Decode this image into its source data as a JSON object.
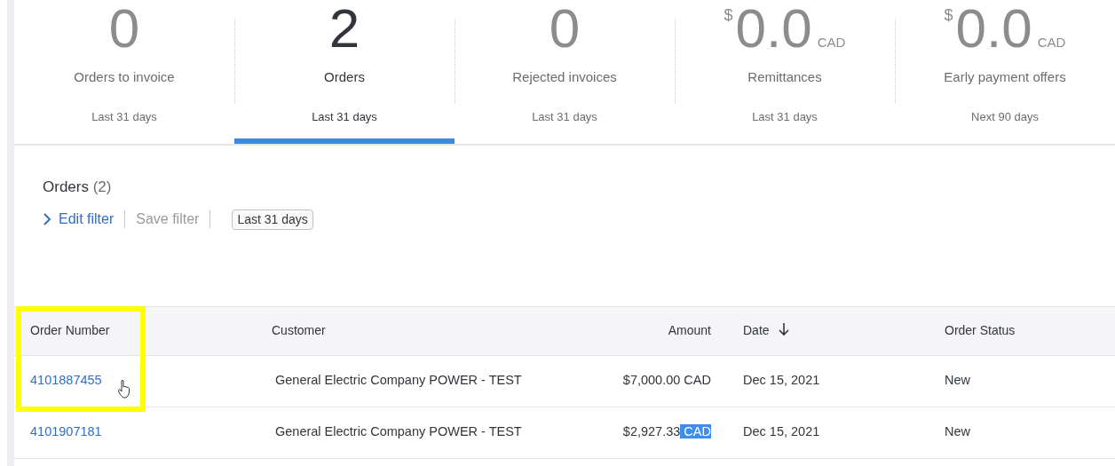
{
  "tiles": [
    {
      "value": "0",
      "label": "Orders to invoice",
      "period": "Last 31 days",
      "selected": false
    },
    {
      "value": "2",
      "label": "Orders",
      "period": "Last 31 days",
      "selected": true
    },
    {
      "value": "0",
      "label": "Rejected invoices",
      "period": "Last 31 days",
      "selected": false
    },
    {
      "prefix": "$",
      "value": "0.0",
      "suffix": "CAD",
      "label": "Remittances",
      "period": "Last 31 days",
      "selected": false
    },
    {
      "prefix": "$",
      "value": "0.0",
      "suffix": "CAD",
      "label": "Early payment offers",
      "period": "Next 90 days",
      "selected": false
    }
  ],
  "section": {
    "title": "Orders",
    "count": "(2)"
  },
  "filter_bar": {
    "edit": "Edit filter",
    "save": "Save filter",
    "save_disabled": true,
    "chip": "Last 31 days"
  },
  "table": {
    "columns": [
      {
        "label": "Order Number",
        "kind": "text",
        "sorted_descending": false,
        "highlighted": true
      },
      {
        "label": "Customer",
        "kind": "text",
        "sorted_descending": false,
        "highlighted": false
      },
      {
        "label": "Amount",
        "kind": "number",
        "sorted_descending": false,
        "highlighted": false
      },
      {
        "label": "Date",
        "kind": "text",
        "sorted_descending": true,
        "highlighted": false
      },
      {
        "label": "Order Status",
        "kind": "text",
        "sorted_descending": false,
        "highlighted": false
      }
    ],
    "rows": [
      {
        "order": "4101887455",
        "customer": "General Electric Company POWER - TEST",
        "amount": "$7,000.00",
        "currency": "CAD",
        "currency_selected": false,
        "date": "Dec 15, 2021",
        "status": "New",
        "highlighted": true,
        "hovered": true
      },
      {
        "order": "4101907181",
        "customer": "General Electric Company POWER - TEST",
        "amount": "$2,927.33",
        "currency": "CAD",
        "currency_selected": true,
        "date": "Dec 15, 2021",
        "status": "New",
        "highlighted": false,
        "hovered": false
      }
    ]
  }
}
